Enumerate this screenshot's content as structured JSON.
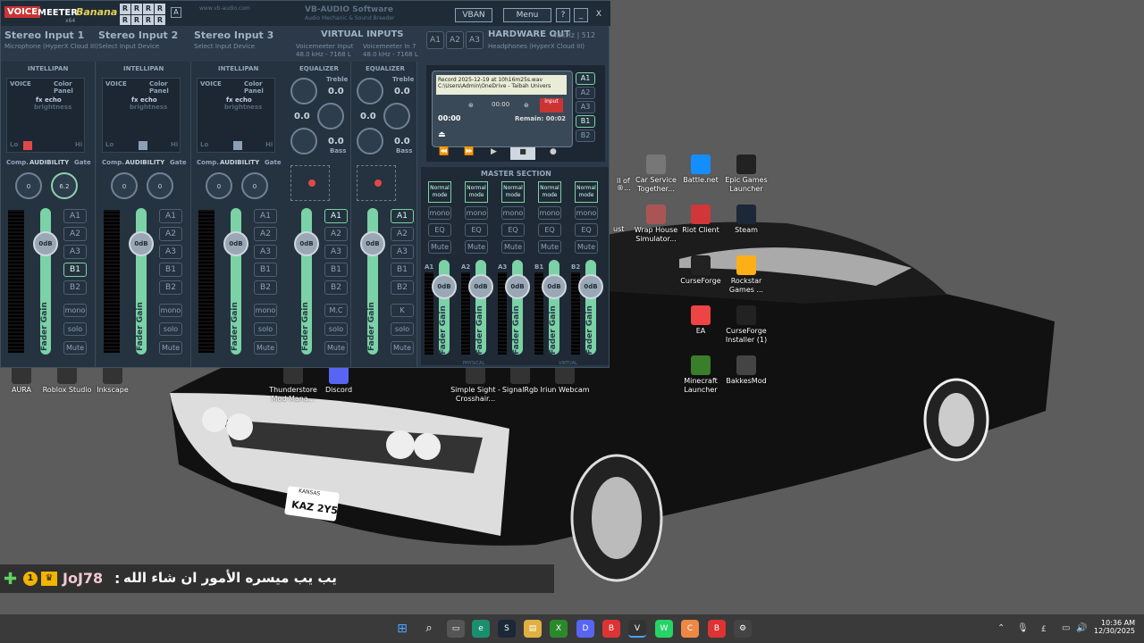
{
  "voicemeeter": {
    "logo_voice": "VOICE",
    "logo_meeter": "MEETER",
    "logo_banana": "Banana",
    "logo_x64": "x64",
    "r_letters": [
      "R",
      "R",
      "R",
      "R",
      "R",
      "R",
      "R",
      "R"
    ],
    "r_extra": "A",
    "vban": "VBAN",
    "menu": "Menu",
    "help": "?",
    "min": "_",
    "close": "X",
    "brand": "VB-AUDIO Software",
    "brand_sub": "Audio Mechanic & Sound Breeder",
    "site": "www.vb-audio.com",
    "inputs": [
      {
        "title": "Stereo Input 1",
        "device": "Microphone (HyperX Cloud III)"
      },
      {
        "title": "Stereo Input 2",
        "device": "Select Input Device"
      },
      {
        "title": "Stereo Input 3",
        "device": "Select Input Device"
      }
    ],
    "virtual_title": "VIRTUAL INPUTS",
    "virtual": [
      {
        "name": "Voicemeeter Input",
        "freq": "48.0 kHz - 7168 L"
      },
      {
        "name": "Voicemeeter In 7",
        "freq": "48.0 kHz - 7168 L"
      }
    ],
    "hw_buttons": [
      "A1",
      "A2",
      "A3"
    ],
    "hw_title": "HARDWARE OUT",
    "hw_freq": "48kHz | 512",
    "hw_device": "Headphones (HyperX Cloud III)",
    "intellipan": "INTELLIPAN",
    "voice": "VOICE",
    "color_panel": "Color Panel",
    "fx_echo": "fx echo",
    "brightness": "brightness",
    "lo": "Lo",
    "hi": "Hi",
    "comp": "Comp.",
    "audibility": "AUDIBILITY",
    "gate": "Gate",
    "knob0": "0",
    "knob62": "6.2",
    "equalizer": "EQUALIZER",
    "treble": "Treble",
    "bass": "Bass",
    "eqval": "0.0",
    "strip_buttons": [
      "A1",
      "A2",
      "A3",
      "B1",
      "B2"
    ],
    "vstrip_buttons": [
      "A1",
      "A2",
      "A3",
      "B1",
      "B2"
    ],
    "mono": "mono",
    "solo": "solo",
    "mute": "Mute",
    "mc": "M.C",
    "k": "K",
    "fader_val": "0dB",
    "fader_label": "Fader Gain",
    "recorder": {
      "file": "Record 2025-12-19 at 10h16m25s.wav",
      "path": "C:\\Users\\Admin\\OneDrive - Taibah Univers",
      "time": "00:00",
      "clock": "00:00",
      "remain": "Remain: 00:02",
      "input": "input",
      "buses": [
        "A1",
        "A2",
        "A3",
        "B1",
        "B2"
      ]
    },
    "master_title": "MASTER SECTION",
    "normal_mode": "Normal mode",
    "master_buses": [
      "A1",
      "A2",
      "A3",
      "B1",
      "B2"
    ],
    "eq": "EQ",
    "physical": "PHYSICAL",
    "virtual_l": "VIRTUAL"
  },
  "desktop": {
    "icons": [
      {
        "name": "Car Service Together...",
        "color": "#777"
      },
      {
        "name": "Battle.net",
        "color": "#148eff"
      },
      {
        "name": "Epic Games Launcher",
        "color": "#222"
      },
      {
        "name": "Wrap House Simulator...",
        "color": "#a55"
      },
      {
        "name": "Riot Client",
        "color": "#d13639"
      },
      {
        "name": "Steam",
        "color": "#1b2838"
      },
      {
        "name": "CurseForge",
        "color": "#222"
      },
      {
        "name": "Rockstar Games ...",
        "color": "#fcaf17"
      },
      {
        "name": "EA",
        "color": "#e44"
      },
      {
        "name": "CurseForge Installer (1)",
        "color": "#222"
      },
      {
        "name": "Minecraft Launcher",
        "color": "#3a7d2a"
      },
      {
        "name": "BakkesMod",
        "color": "#444"
      },
      {
        "name": "AURA",
        "color": "#333"
      },
      {
        "name": "Roblox Studio",
        "color": "#333"
      },
      {
        "name": "Inkscape",
        "color": "#333"
      },
      {
        "name": "Thunderstore Mod Mana...",
        "color": "#333"
      },
      {
        "name": "Discord",
        "color": "#5865f2"
      },
      {
        "name": "Simple Sight - Crosshair...",
        "color": "#333"
      },
      {
        "name": "SignalRgb",
        "color": "#333"
      },
      {
        "name": "Iriun Webcam",
        "color": "#333"
      }
    ],
    "partial": [
      "ll of",
      "®...",
      "ust"
    ],
    "plate_state": "KANSAS",
    "plate": "KAZ 2Y5"
  },
  "chat": {
    "user": "JoJ78",
    "sep": ":",
    "message": "يب يب ميسره الأمور ان شاء الله"
  },
  "taskbar": {
    "time": "10:36 AM",
    "date": "12/30/2025",
    "lang": "£"
  }
}
